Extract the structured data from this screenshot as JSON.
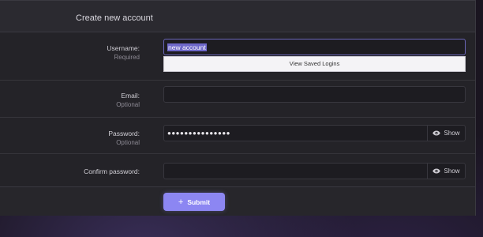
{
  "form": {
    "title": "Create new account",
    "username": {
      "label": "Username:",
      "sublabel": "Required",
      "value": "new account",
      "suggestion": "View Saved Logins"
    },
    "email": {
      "label": "Email:",
      "sublabel": "Optional",
      "value": ""
    },
    "password": {
      "label": "Password:",
      "sublabel": "Optional",
      "masked_value": "●●●●●●●●●●●●●●●",
      "show_label": "Show"
    },
    "confirm_password": {
      "label": "Confirm password:",
      "masked_value": "",
      "show_label": "Show"
    },
    "submit_label": "Submit",
    "submit_icon": "plus-icon"
  },
  "colors": {
    "accent": "#8c86f2",
    "selection": "#6e68c9",
    "panel": "#242328"
  }
}
